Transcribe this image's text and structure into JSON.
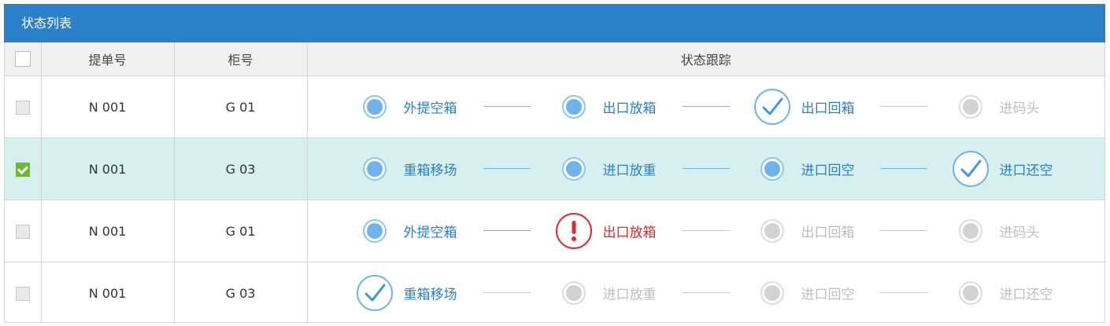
{
  "panel": {
    "title": "状态列表"
  },
  "columns": {
    "order_no": "提单号",
    "container_no": "柜号",
    "status_track": "状态跟踪"
  },
  "colors": {
    "header_bg": "#2a81c8",
    "done": "#2a7fc6",
    "error": "#e8262b",
    "pending": "#c8c8c8",
    "selected_row": "#d6f0f0",
    "checkbox_checked": "#6cba2d"
  },
  "rows": [
    {
      "checked": false,
      "order_no": "N 001",
      "container_no": "G 01",
      "steps": [
        {
          "label": "外提空箱",
          "state": "done"
        },
        {
          "label": "出口放箱",
          "state": "done"
        },
        {
          "label": "出口回箱",
          "state": "check"
        },
        {
          "label": "进码头",
          "state": "pending"
        }
      ]
    },
    {
      "checked": true,
      "order_no": "N 001",
      "container_no": "G 03",
      "steps": [
        {
          "label": "重箱移场",
          "state": "done"
        },
        {
          "label": "进口放重",
          "state": "done"
        },
        {
          "label": "进口回空",
          "state": "done"
        },
        {
          "label": "进口还空",
          "state": "check"
        }
      ]
    },
    {
      "checked": false,
      "order_no": "N 001",
      "container_no": "G 01",
      "steps": [
        {
          "label": "外提空箱",
          "state": "done"
        },
        {
          "label": "出口放箱",
          "state": "error"
        },
        {
          "label": "出口回箱",
          "state": "pending"
        },
        {
          "label": "进码头",
          "state": "pending"
        }
      ]
    },
    {
      "checked": false,
      "order_no": "N 001",
      "container_no": "G 03",
      "steps": [
        {
          "label": "重箱移场",
          "state": "check"
        },
        {
          "label": "进口放重",
          "state": "pending"
        },
        {
          "label": "进口回空",
          "state": "pending"
        },
        {
          "label": "进口还空",
          "state": "pending"
        }
      ]
    }
  ]
}
